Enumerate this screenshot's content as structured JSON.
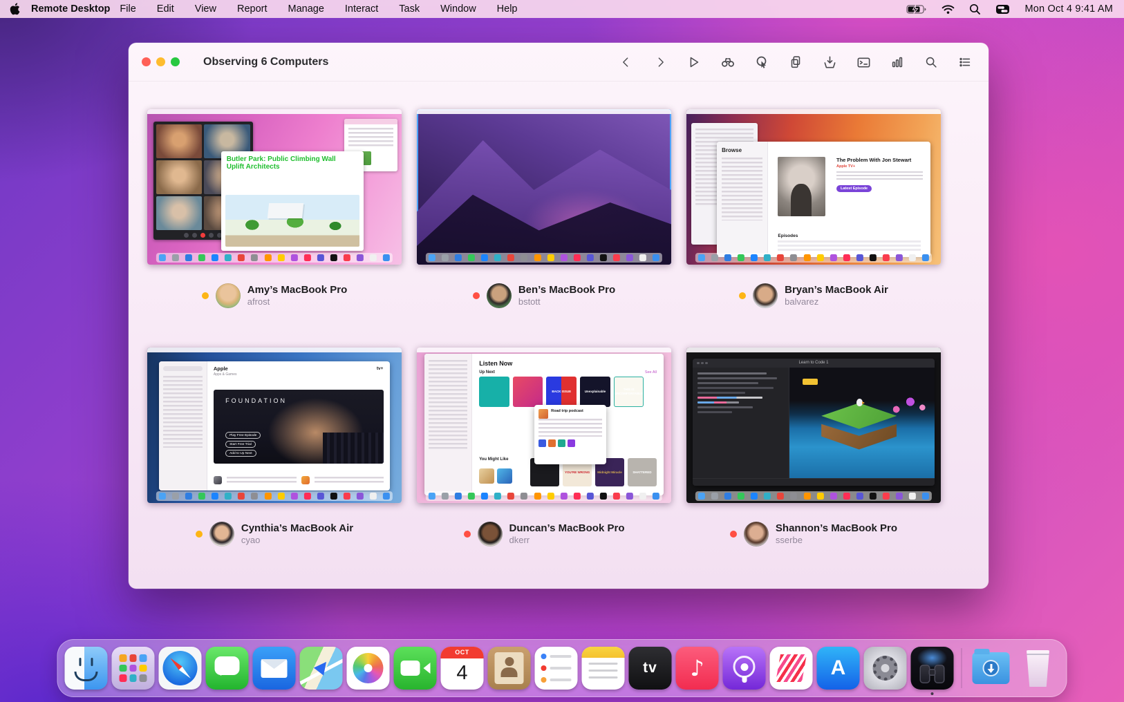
{
  "menu_bar": {
    "app_name": "Remote Desktop",
    "menus": [
      "File",
      "Edit",
      "View",
      "Report",
      "Manage",
      "Interact",
      "Task",
      "Window",
      "Help"
    ],
    "clock": "Mon Oct 4  9:41 AM"
  },
  "window": {
    "title": "Observing 6 Computers",
    "toolbar_icons": [
      "back",
      "forward",
      "run-task",
      "observe",
      "control",
      "copy-items",
      "install-package",
      "unix-command",
      "reports",
      "spotlight",
      "list-view"
    ]
  },
  "computers": [
    {
      "name": "Amy’s MacBook Pro",
      "user": "afrost",
      "status": "#fdb515"
    },
    {
      "name": "Ben’s MacBook Pro",
      "user": "bstott",
      "status": "#ff4f43"
    },
    {
      "name": "Bryan’s MacBook Air",
      "user": "balvarez",
      "status": "#fdb515"
    },
    {
      "name": "Cynthia’s MacBook Air",
      "user": "cyao",
      "status": "#fdb515"
    },
    {
      "name": "Duncan’s MacBook Pro",
      "user": "dkerr",
      "status": "#ff4f43"
    },
    {
      "name": "Shannon’s MacBook Pro",
      "user": "sserbe",
      "status": "#ff4f43"
    }
  ],
  "thumbs": {
    "amy": {
      "doc_line1": "Butler Park: Public Climbing Wall",
      "doc_line2": "Uplift Architects"
    },
    "bryan": {
      "sidebar_title": "Browse",
      "show_title": "The Problem With Jon Stewart",
      "channel": "Apple TV+",
      "button": "Latest Episode",
      "section": "Episodes"
    },
    "cynthia": {
      "heading": "Apple",
      "subheading": "Apps & Games",
      "logo": "tv+",
      "hero_title": "FOUNDATION",
      "btn1": "Play Free Episode",
      "btn2": "Start Free Trial",
      "btn3": "Add to Up Next"
    },
    "duncan": {
      "page_title": "Listen Now",
      "section": "Up Next",
      "see_all": "See All",
      "cover_back_issue": "BACK ISSUE",
      "cover_unexplainable": "Unexplainable",
      "cover_uncomfortable": "THIS IS UNCOMFORTABLE",
      "popup_title": "Road trip podcast",
      "section2": "You Might Like",
      "cover_youre_wrong": "YOU’RE WRONG",
      "cover_midnight": "Midnight Miracle",
      "cover_shattered": "SHATTERED"
    },
    "shannon": {
      "window_title": "Learn to Code 1"
    }
  },
  "dock": {
    "items": [
      "finder",
      "launchpad",
      "safari",
      "messages",
      "mail",
      "maps",
      "photos",
      "facetime",
      "calendar",
      "contacts",
      "reminders",
      "notes",
      "apple-tv",
      "music",
      "podcasts",
      "news",
      "app-store",
      "system-preferences",
      "remote-desktop",
      "divider",
      "downloads",
      "trash"
    ],
    "calendar_month": "OCT",
    "calendar_day": "4",
    "active_app": "remote-desktop"
  },
  "status_colors": {
    "online_yellow": "#fdb515",
    "offline_red": "#ff4f43",
    "selection_blue": "#4da3ff"
  },
  "mini_dock_palette": [
    "#4aa3f5",
    "#9aa0a8",
    "#2f7de1",
    "#34c759",
    "#1b84ff",
    "#30b0c7",
    "#e8453a",
    "#8e8e93",
    "#ff9500",
    "#ffcc00",
    "#af52de",
    "#ff2d55",
    "#5856d6",
    "#111111",
    "#fa3c4c",
    "#8a56d8",
    "#f0f0f0",
    "#3a90f0"
  ],
  "launchpad_palette": [
    "#f5a623",
    "#e8453a",
    "#4aa3f5",
    "#34c759",
    "#af52de",
    "#ffcc00",
    "#ff2d55",
    "#30b0c7",
    "#8e8e93"
  ]
}
